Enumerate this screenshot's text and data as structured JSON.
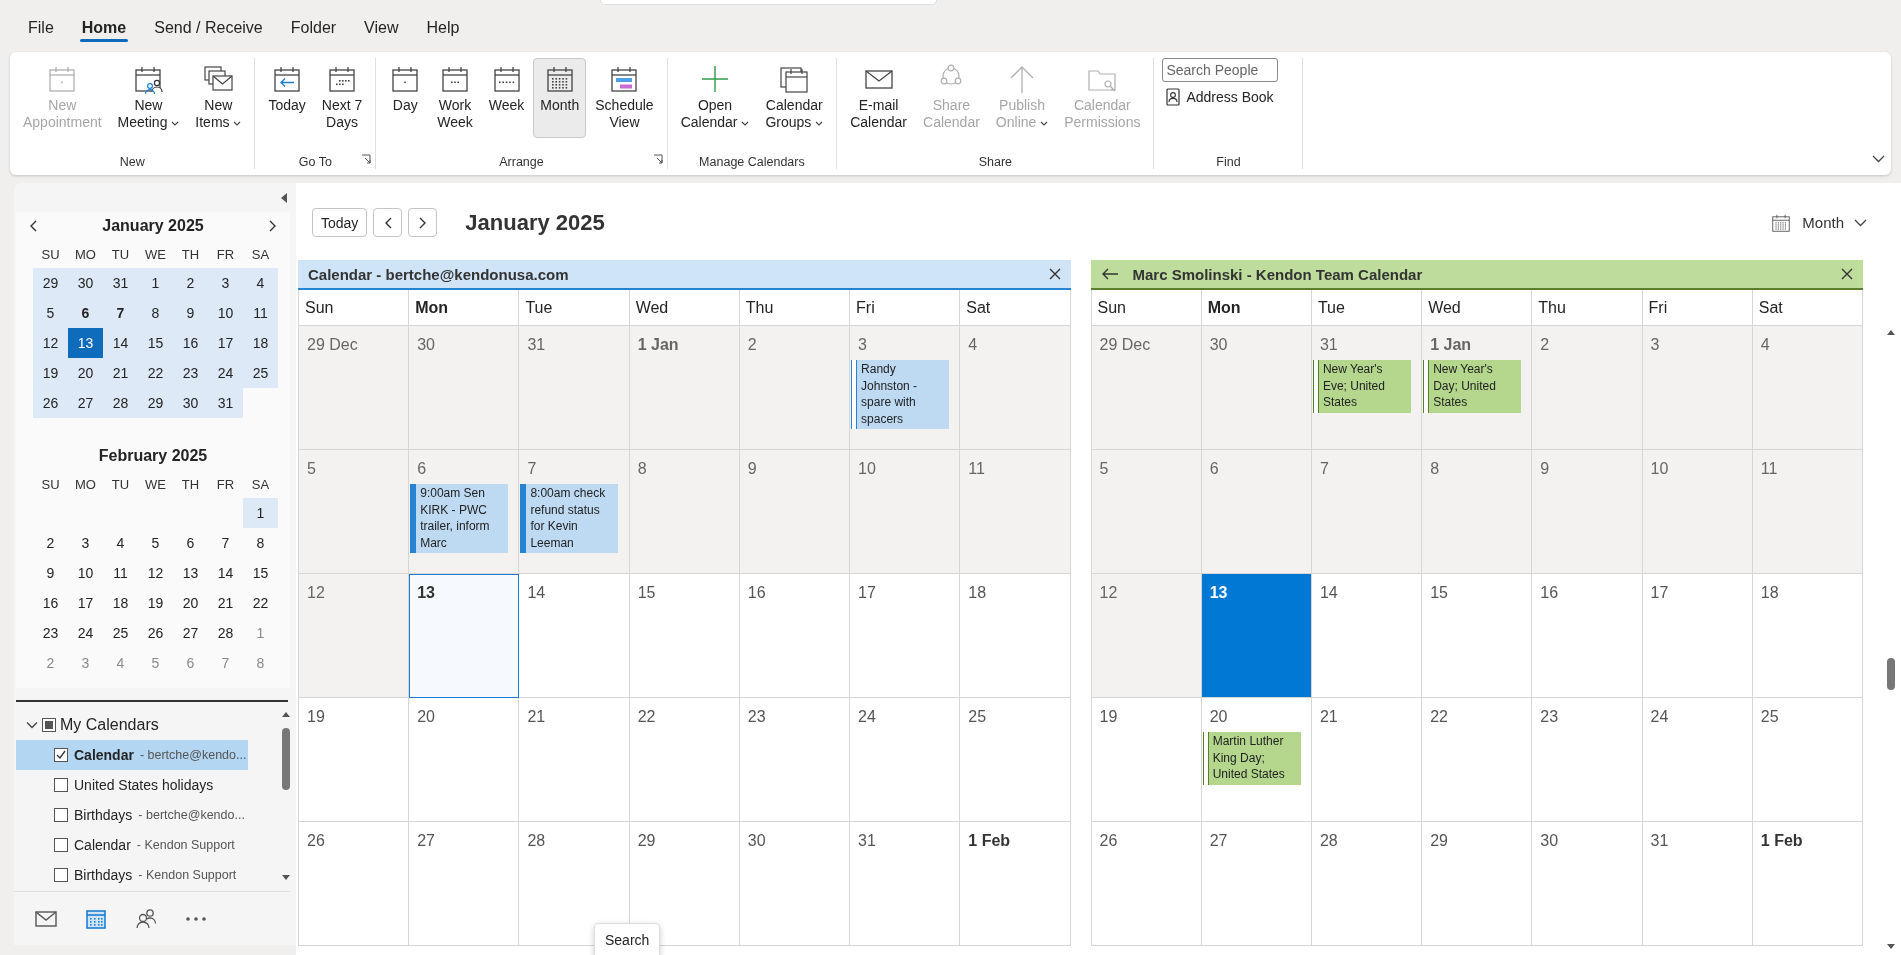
{
  "menu_tabs": [
    {
      "label": "File",
      "selected": false
    },
    {
      "label": "Home",
      "selected": true
    },
    {
      "label": "Send / Receive",
      "selected": false
    },
    {
      "label": "Folder",
      "selected": false
    },
    {
      "label": "View",
      "selected": false
    },
    {
      "label": "Help",
      "selected": false
    }
  ],
  "ribbon": {
    "groups": [
      {
        "kind": "buttons",
        "label": "New",
        "launcher": false,
        "buttons": [
          {
            "lines": [
              "New",
              "Appointment"
            ],
            "disabled": true,
            "selected": false,
            "dropdown": false
          },
          {
            "lines": [
              "New",
              "Meeting"
            ],
            "disabled": false,
            "selected": false,
            "dropdown": true
          },
          {
            "lines": [
              "New",
              "Items"
            ],
            "disabled": false,
            "selected": false,
            "dropdown": true
          }
        ]
      },
      {
        "kind": "buttons",
        "label": "Go To",
        "launcher": true,
        "buttons": [
          {
            "lines": [
              "Today"
            ],
            "disabled": false,
            "selected": false,
            "dropdown": false
          },
          {
            "lines": [
              "Next 7",
              "Days"
            ],
            "disabled": false,
            "selected": false,
            "dropdown": false
          }
        ]
      },
      {
        "kind": "buttons",
        "label": "Arrange",
        "launcher": true,
        "buttons": [
          {
            "lines": [
              "Day"
            ],
            "disabled": false,
            "selected": false,
            "dropdown": false
          },
          {
            "lines": [
              "Work",
              "Week"
            ],
            "disabled": false,
            "selected": false,
            "dropdown": false
          },
          {
            "lines": [
              "Week"
            ],
            "disabled": false,
            "selected": false,
            "dropdown": false
          },
          {
            "lines": [
              "Month"
            ],
            "disabled": false,
            "selected": true,
            "dropdown": false
          },
          {
            "lines": [
              "Schedule",
              "View"
            ],
            "disabled": false,
            "selected": false,
            "dropdown": false
          }
        ]
      },
      {
        "kind": "buttons",
        "label": "Manage Calendars",
        "launcher": false,
        "buttons": [
          {
            "lines": [
              "Open",
              "Calendar"
            ],
            "disabled": false,
            "selected": false,
            "dropdown": true
          },
          {
            "lines": [
              "Calendar",
              "Groups"
            ],
            "disabled": false,
            "selected": false,
            "dropdown": true
          }
        ]
      },
      {
        "kind": "buttons",
        "label": "Share",
        "launcher": false,
        "buttons": [
          {
            "lines": [
              "E-mail",
              "Calendar"
            ],
            "disabled": false,
            "selected": false,
            "dropdown": false
          },
          {
            "lines": [
              "Share",
              "Calendar"
            ],
            "disabled": true,
            "selected": false,
            "dropdown": false
          },
          {
            "lines": [
              "Publish",
              "Online"
            ],
            "disabled": true,
            "selected": false,
            "dropdown": true
          },
          {
            "lines": [
              "Calendar",
              "Permissions"
            ],
            "disabled": true,
            "selected": false,
            "dropdown": false
          }
        ]
      },
      {
        "kind": "find",
        "label": "Find",
        "launcher": false,
        "search": {
          "placeholder": "Search People"
        },
        "links": [
          {
            "label": "Address Book"
          }
        ]
      }
    ]
  },
  "mini_calendars": [
    {
      "title": "January 2025",
      "prev_button": true,
      "next_button": true,
      "weekdays": [
        "SU",
        "MO",
        "TU",
        "WE",
        "TH",
        "FR",
        "SA"
      ],
      "weeks": [
        [
          {
            "kind": "day",
            "day": "29",
            "in_view": true,
            "bold": false,
            "selected": false,
            "dimmed": false
          },
          {
            "kind": "day",
            "day": "30",
            "in_view": true,
            "bold": false,
            "selected": false,
            "dimmed": false
          },
          {
            "kind": "day",
            "day": "31",
            "in_view": true,
            "bold": false,
            "selected": false,
            "dimmed": false
          },
          {
            "kind": "day",
            "day": "1",
            "in_view": true,
            "bold": false,
            "selected": false,
            "dimmed": false
          },
          {
            "kind": "day",
            "day": "2",
            "in_view": true,
            "bold": false,
            "selected": false,
            "dimmed": false
          },
          {
            "kind": "day",
            "day": "3",
            "in_view": true,
            "bold": false,
            "selected": false,
            "dimmed": false
          },
          {
            "kind": "day",
            "day": "4",
            "in_view": true,
            "bold": false,
            "selected": false,
            "dimmed": false
          }
        ],
        [
          {
            "kind": "day",
            "day": "5",
            "in_view": true,
            "bold": false,
            "selected": false,
            "dimmed": false
          },
          {
            "kind": "day",
            "day": "6",
            "in_view": true,
            "bold": true,
            "selected": false,
            "dimmed": false
          },
          {
            "kind": "day",
            "day": "7",
            "in_view": true,
            "bold": true,
            "selected": false,
            "dimmed": false
          },
          {
            "kind": "day",
            "day": "8",
            "in_view": true,
            "bold": false,
            "selected": false,
            "dimmed": false
          },
          {
            "kind": "day",
            "day": "9",
            "in_view": true,
            "bold": false,
            "selected": false,
            "dimmed": false
          },
          {
            "kind": "day",
            "day": "10",
            "in_view": true,
            "bold": false,
            "selected": false,
            "dimmed": false
          },
          {
            "kind": "day",
            "day": "11",
            "in_view": true,
            "bold": false,
            "selected": false,
            "dimmed": false
          }
        ],
        [
          {
            "kind": "day",
            "day": "12",
            "in_view": true,
            "bold": false,
            "selected": false,
            "dimmed": false
          },
          {
            "kind": "day",
            "day": "13",
            "in_view": true,
            "bold": false,
            "selected": true,
            "dimmed": false
          },
          {
            "kind": "day",
            "day": "14",
            "in_view": true,
            "bold": false,
            "selected": false,
            "dimmed": false
          },
          {
            "kind": "day",
            "day": "15",
            "in_view": true,
            "bold": false,
            "selected": false,
            "dimmed": false
          },
          {
            "kind": "day",
            "day": "16",
            "in_view": true,
            "bold": false,
            "selected": false,
            "dimmed": false
          },
          {
            "kind": "day",
            "day": "17",
            "in_view": true,
            "bold": false,
            "selected": false,
            "dimmed": false
          },
          {
            "kind": "day",
            "day": "18",
            "in_view": true,
            "bold": false,
            "selected": false,
            "dimmed": false
          }
        ],
        [
          {
            "kind": "day",
            "day": "19",
            "in_view": true,
            "bold": false,
            "selected": false,
            "dimmed": false
          },
          {
            "kind": "day",
            "day": "20",
            "in_view": true,
            "bold": false,
            "selected": false,
            "dimmed": false
          },
          {
            "kind": "day",
            "day": "21",
            "in_view": true,
            "bold": false,
            "selected": false,
            "dimmed": false
          },
          {
            "kind": "day",
            "day": "22",
            "in_view": true,
            "bold": false,
            "selected": false,
            "dimmed": false
          },
          {
            "kind": "day",
            "day": "23",
            "in_view": true,
            "bold": false,
            "selected": false,
            "dimmed": false
          },
          {
            "kind": "day",
            "day": "24",
            "in_view": true,
            "bold": false,
            "selected": false,
            "dimmed": false
          },
          {
            "kind": "day",
            "day": "25",
            "in_view": true,
            "bold": false,
            "selected": false,
            "dimmed": false
          }
        ],
        [
          {
            "kind": "day",
            "day": "26",
            "in_view": true,
            "bold": false,
            "selected": false,
            "dimmed": false
          },
          {
            "kind": "day",
            "day": "27",
            "in_view": true,
            "bold": false,
            "selected": false,
            "dimmed": false
          },
          {
            "kind": "day",
            "day": "28",
            "in_view": true,
            "bold": false,
            "selected": false,
            "dimmed": false
          },
          {
            "kind": "day",
            "day": "29",
            "in_view": true,
            "bold": false,
            "selected": false,
            "dimmed": false
          },
          {
            "kind": "day",
            "day": "30",
            "in_view": true,
            "bold": false,
            "selected": false,
            "dimmed": false
          },
          {
            "kind": "day",
            "day": "31",
            "in_view": true,
            "bold": false,
            "selected": false,
            "dimmed": false
          }
        ]
      ]
    },
    {
      "title": "February 2025",
      "prev_button": false,
      "next_button": false,
      "weekdays": [
        "SU",
        "MO",
        "TU",
        "WE",
        "TH",
        "FR",
        "SA"
      ],
      "weeks": [
        [
          {
            "kind": "blank"
          },
          {
            "kind": "blank"
          },
          {
            "kind": "blank"
          },
          {
            "kind": "blank"
          },
          {
            "kind": "blank"
          },
          {
            "kind": "blank"
          },
          {
            "kind": "day",
            "day": "1",
            "in_view": true,
            "bold": false,
            "selected": false,
            "dimmed": false
          }
        ],
        [
          {
            "kind": "day",
            "day": "2",
            "in_view": false,
            "bold": false,
            "selected": false,
            "dimmed": false
          },
          {
            "kind": "day",
            "day": "3",
            "in_view": false,
            "bold": false,
            "selected": false,
            "dimmed": false
          },
          {
            "kind": "day",
            "day": "4",
            "in_view": false,
            "bold": false,
            "selected": false,
            "dimmed": false
          },
          {
            "kind": "day",
            "day": "5",
            "in_view": false,
            "bold": false,
            "selected": false,
            "dimmed": false
          },
          {
            "kind": "day",
            "day": "6",
            "in_view": false,
            "bold": false,
            "selected": false,
            "dimmed": false
          },
          {
            "kind": "day",
            "day": "7",
            "in_view": false,
            "bold": false,
            "selected": false,
            "dimmed": false
          },
          {
            "kind": "day",
            "day": "8",
            "in_view": false,
            "bold": false,
            "selected": false,
            "dimmed": false
          }
        ],
        [
          {
            "kind": "day",
            "day": "9",
            "in_view": false,
            "bold": false,
            "selected": false,
            "dimmed": false
          },
          {
            "kind": "day",
            "day": "10",
            "in_view": false,
            "bold": false,
            "selected": false,
            "dimmed": false
          },
          {
            "kind": "day",
            "day": "11",
            "in_view": false,
            "bold": false,
            "selected": false,
            "dimmed": false
          },
          {
            "kind": "day",
            "day": "12",
            "in_view": false,
            "bold": false,
            "selected": false,
            "dimmed": false
          },
          {
            "kind": "day",
            "day": "13",
            "in_view": false,
            "bold": false,
            "selected": false,
            "dimmed": false
          },
          {
            "kind": "day",
            "day": "14",
            "in_view": false,
            "bold": false,
            "selected": false,
            "dimmed": false
          },
          {
            "kind": "day",
            "day": "15",
            "in_view": false,
            "bold": false,
            "selected": false,
            "dimmed": false
          }
        ],
        [
          {
            "kind": "day",
            "day": "16",
            "in_view": false,
            "bold": false,
            "selected": false,
            "dimmed": false
          },
          {
            "kind": "day",
            "day": "17",
            "in_view": false,
            "bold": false,
            "selected": false,
            "dimmed": false
          },
          {
            "kind": "day",
            "day": "18",
            "in_view": false,
            "bold": false,
            "selected": false,
            "dimmed": false
          },
          {
            "kind": "day",
            "day": "19",
            "in_view": false,
            "bold": false,
            "selected": false,
            "dimmed": false
          },
          {
            "kind": "day",
            "day": "20",
            "in_view": false,
            "bold": false,
            "selected": false,
            "dimmed": false
          },
          {
            "kind": "day",
            "day": "21",
            "in_view": false,
            "bold": false,
            "selected": false,
            "dimmed": false
          },
          {
            "kind": "day",
            "day": "22",
            "in_view": false,
            "bold": false,
            "selected": false,
            "dimmed": false
          }
        ],
        [
          {
            "kind": "day",
            "day": "23",
            "in_view": false,
            "bold": false,
            "selected": false,
            "dimmed": false
          },
          {
            "kind": "day",
            "day": "24",
            "in_view": false,
            "bold": false,
            "selected": false,
            "dimmed": false
          },
          {
            "kind": "day",
            "day": "25",
            "in_view": false,
            "bold": false,
            "selected": false,
            "dimmed": false
          },
          {
            "kind": "day",
            "day": "26",
            "in_view": false,
            "bold": false,
            "selected": false,
            "dimmed": false
          },
          {
            "kind": "day",
            "day": "27",
            "in_view": false,
            "bold": false,
            "selected": false,
            "dimmed": false
          },
          {
            "kind": "day",
            "day": "28",
            "in_view": false,
            "bold": false,
            "selected": false,
            "dimmed": false
          },
          {
            "kind": "day",
            "day": "1",
            "in_view": false,
            "bold": false,
            "selected": false,
            "dimmed": true
          }
        ],
        [
          {
            "kind": "day",
            "day": "2",
            "in_view": false,
            "bold": false,
            "selected": false,
            "dimmed": true
          },
          {
            "kind": "day",
            "day": "3",
            "in_view": false,
            "bold": false,
            "selected": false,
            "dimmed": true
          },
          {
            "kind": "day",
            "day": "4",
            "in_view": false,
            "bold": false,
            "selected": false,
            "dimmed": true
          },
          {
            "kind": "day",
            "day": "5",
            "in_view": false,
            "bold": false,
            "selected": false,
            "dimmed": true
          },
          {
            "kind": "day",
            "day": "6",
            "in_view": false,
            "bold": false,
            "selected": false,
            "dimmed": true
          },
          {
            "kind": "day",
            "day": "7",
            "in_view": false,
            "bold": false,
            "selected": false,
            "dimmed": true
          },
          {
            "kind": "day",
            "day": "8",
            "in_view": false,
            "bold": false,
            "selected": false,
            "dimmed": true
          }
        ]
      ]
    }
  ],
  "calendar_list": {
    "label": "My Calendars",
    "expanded": true,
    "mixed": true,
    "items": [
      {
        "name": "Calendar",
        "owner": "- bertche@kendo...",
        "checked": true,
        "selected": true
      },
      {
        "name": "United States holidays",
        "checked": false,
        "selected": false
      },
      {
        "name": "Birthdays",
        "owner": "- bertche@kendo...",
        "checked": false,
        "selected": false
      },
      {
        "name": "Calendar",
        "owner": "- Kendon Support",
        "checked": false,
        "selected": false
      },
      {
        "name": "Birthdays",
        "owner": "- Kendon Support",
        "checked": false,
        "selected": false
      }
    ]
  },
  "nav_bar": [
    {
      "selected": false
    },
    {
      "selected": true
    },
    {
      "selected": false
    },
    {
      "selected": false
    }
  ],
  "toolbar": {
    "today": "Today",
    "title": "January 2025",
    "view": "Month"
  },
  "calendars": [
    {
      "title": "Calendar - bertche@kendonusa.com",
      "color": "#cfe4f6",
      "back_button": false,
      "selected": true,
      "weekdays": [
        {
          "label": "Sun",
          "bold": false
        },
        {
          "label": "Mon",
          "bold": true
        },
        {
          "label": "Tue",
          "bold": false
        },
        {
          "label": "Wed",
          "bold": false
        },
        {
          "label": "Thu",
          "bold": false
        },
        {
          "label": "Fri",
          "bold": false
        },
        {
          "label": "Sat",
          "bold": false
        }
      ],
      "weeks": [
        [
          {
            "label": "29 Dec",
            "bold": false,
            "past": true,
            "today": false
          },
          {
            "label": "30",
            "bold": false,
            "past": true,
            "today": false
          },
          {
            "label": "31",
            "bold": false,
            "past": true,
            "today": false
          },
          {
            "label": "1 Jan",
            "bold": true,
            "past": true,
            "today": false
          },
          {
            "label": "2",
            "bold": false,
            "past": true,
            "today": false
          },
          {
            "label": "3",
            "bold": false,
            "past": true,
            "today": false,
            "events": [
              {
                "text": "Randy Johnston - spare with spacers",
                "busy": false
              }
            ]
          },
          {
            "label": "4",
            "bold": false,
            "past": true,
            "today": false
          }
        ],
        [
          {
            "label": "5",
            "bold": false,
            "past": true,
            "today": false
          },
          {
            "label": "6",
            "bold": false,
            "past": true,
            "today": false,
            "events": [
              {
                "text": "9:00am Sen KIRK - PWC trailer, inform Marc",
                "busy": true
              }
            ]
          },
          {
            "label": "7",
            "bold": false,
            "past": true,
            "today": false,
            "events": [
              {
                "text": "8:00am check refund status for Kevin Leeman",
                "busy": true
              }
            ]
          },
          {
            "label": "8",
            "bold": false,
            "past": true,
            "today": false
          },
          {
            "label": "9",
            "bold": false,
            "past": true,
            "today": false
          },
          {
            "label": "10",
            "bold": false,
            "past": true,
            "today": false
          },
          {
            "label": "11",
            "bold": false,
            "past": true,
            "today": false
          }
        ],
        [
          {
            "label": "12",
            "bold": false,
            "past": true,
            "today": false
          },
          {
            "label": "13",
            "bold": true,
            "past": false,
            "today": true
          },
          {
            "label": "14",
            "bold": false,
            "past": false,
            "today": false
          },
          {
            "label": "15",
            "bold": false,
            "past": false,
            "today": false
          },
          {
            "label": "16",
            "bold": false,
            "past": false,
            "today": false
          },
          {
            "label": "17",
            "bold": false,
            "past": false,
            "today": false
          },
          {
            "label": "18",
            "bold": false,
            "past": false,
            "today": false
          }
        ],
        [
          {
            "label": "19",
            "bold": false,
            "past": false,
            "today": false
          },
          {
            "label": "20",
            "bold": false,
            "past": false,
            "today": false
          },
          {
            "label": "21",
            "bold": false,
            "past": false,
            "today": false
          },
          {
            "label": "22",
            "bold": false,
            "past": false,
            "today": false
          },
          {
            "label": "23",
            "bold": false,
            "past": false,
            "today": false
          },
          {
            "label": "24",
            "bold": false,
            "past": false,
            "today": false
          },
          {
            "label": "25",
            "bold": false,
            "past": false,
            "today": false
          }
        ],
        [
          {
            "label": "26",
            "bold": false,
            "past": false,
            "today": false
          },
          {
            "label": "27",
            "bold": false,
            "past": false,
            "today": false
          },
          {
            "label": "28",
            "bold": false,
            "past": false,
            "today": false
          },
          {
            "label": "29",
            "bold": false,
            "past": false,
            "today": false
          },
          {
            "label": "30",
            "bold": false,
            "past": false,
            "today": false
          },
          {
            "label": "31",
            "bold": false,
            "past": false,
            "today": false
          },
          {
            "label": "1 Feb",
            "bold": true,
            "past": false,
            "today": false
          }
        ]
      ]
    },
    {
      "title": "Marc Smolinski - Kendon Team Calendar",
      "color": "#bedc9c",
      "back_button": true,
      "selected": false,
      "weekdays": [
        {
          "label": "Sun",
          "bold": false
        },
        {
          "label": "Mon",
          "bold": true
        },
        {
          "label": "Tue",
          "bold": false
        },
        {
          "label": "Wed",
          "bold": false
        },
        {
          "label": "Thu",
          "bold": false
        },
        {
          "label": "Fri",
          "bold": false
        },
        {
          "label": "Sat",
          "bold": false
        }
      ],
      "weeks": [
        [
          {
            "label": "29 Dec",
            "bold": false,
            "past": true,
            "today": false
          },
          {
            "label": "30",
            "bold": false,
            "past": true,
            "today": false
          },
          {
            "label": "31",
            "bold": false,
            "past": true,
            "today": false,
            "events": [
              {
                "text": "New Year's Eve; United States",
                "busy": false
              }
            ]
          },
          {
            "label": "1 Jan",
            "bold": true,
            "past": true,
            "today": false,
            "events": [
              {
                "text": "New Year's Day; United States",
                "busy": false
              }
            ]
          },
          {
            "label": "2",
            "bold": false,
            "past": true,
            "today": false
          },
          {
            "label": "3",
            "bold": false,
            "past": true,
            "today": false
          },
          {
            "label": "4",
            "bold": false,
            "past": true,
            "today": false
          }
        ],
        [
          {
            "label": "5",
            "bold": false,
            "past": true,
            "today": false
          },
          {
            "label": "6",
            "bold": false,
            "past": true,
            "today": false
          },
          {
            "label": "7",
            "bold": false,
            "past": true,
            "today": false
          },
          {
            "label": "8",
            "bold": false,
            "past": true,
            "today": false
          },
          {
            "label": "9",
            "bold": false,
            "past": true,
            "today": false
          },
          {
            "label": "10",
            "bold": false,
            "past": true,
            "today": false
          },
          {
            "label": "11",
            "bold": false,
            "past": true,
            "today": false
          }
        ],
        [
          {
            "label": "12",
            "bold": false,
            "past": true,
            "today": false
          },
          {
            "label": "13",
            "bold": true,
            "past": false,
            "today": true
          },
          {
            "label": "14",
            "bold": false,
            "past": false,
            "today": false
          },
          {
            "label": "15",
            "bold": false,
            "past": false,
            "today": false
          },
          {
            "label": "16",
            "bold": false,
            "past": false,
            "today": false
          },
          {
            "label": "17",
            "bold": false,
            "past": false,
            "today": false
          },
          {
            "label": "18",
            "bold": false,
            "past": false,
            "today": false
          }
        ],
        [
          {
            "label": "19",
            "bold": false,
            "past": false,
            "today": false
          },
          {
            "label": "20",
            "bold": false,
            "past": false,
            "today": false,
            "events": [
              {
                "text": "Martin Luther King Day; United States",
                "busy": false
              }
            ]
          },
          {
            "label": "21",
            "bold": false,
            "past": false,
            "today": false
          },
          {
            "label": "22",
            "bold": false,
            "past": false,
            "today": false
          },
          {
            "label": "23",
            "bold": false,
            "past": false,
            "today": false
          },
          {
            "label": "24",
            "bold": false,
            "past": false,
            "today": false
          },
          {
            "label": "25",
            "bold": false,
            "past": false,
            "today": false
          }
        ],
        [
          {
            "label": "26",
            "bold": false,
            "past": false,
            "today": false
          },
          {
            "label": "27",
            "bold": false,
            "past": false,
            "today": false
          },
          {
            "label": "28",
            "bold": false,
            "past": false,
            "today": false
          },
          {
            "label": "29",
            "bold": false,
            "past": false,
            "today": false
          },
          {
            "label": "30",
            "bold": false,
            "past": false,
            "today": false
          },
          {
            "label": "31",
            "bold": false,
            "past": false,
            "today": false
          },
          {
            "label": "1 Feb",
            "bold": true,
            "past": false,
            "today": false
          }
        ]
      ]
    }
  ],
  "tooltip": {
    "text": "Search"
  }
}
